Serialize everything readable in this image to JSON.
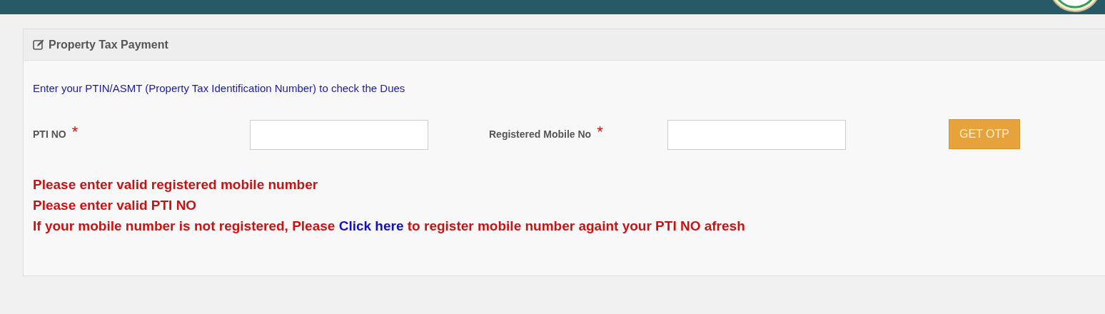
{
  "panel": {
    "title": "Property Tax Payment"
  },
  "instruction": "Enter your PTIN/ASMT (Property Tax Identification Number) to check the Dues",
  "fields": [
    {
      "label": "PTI NO",
      "required_mark": "*"
    },
    {
      "label": "Registered Mobile No",
      "required_mark": "*"
    }
  ],
  "button": "GET OTP",
  "errors": [
    {
      "text": "Please enter valid registered mobile number"
    },
    {
      "text": "Please enter valid PTI NO"
    },
    {
      "before": "If your mobile number is not registered, Please ",
      "link": "Click here",
      "after": " to register mobile number againt your PTI NO afresh"
    }
  ]
}
